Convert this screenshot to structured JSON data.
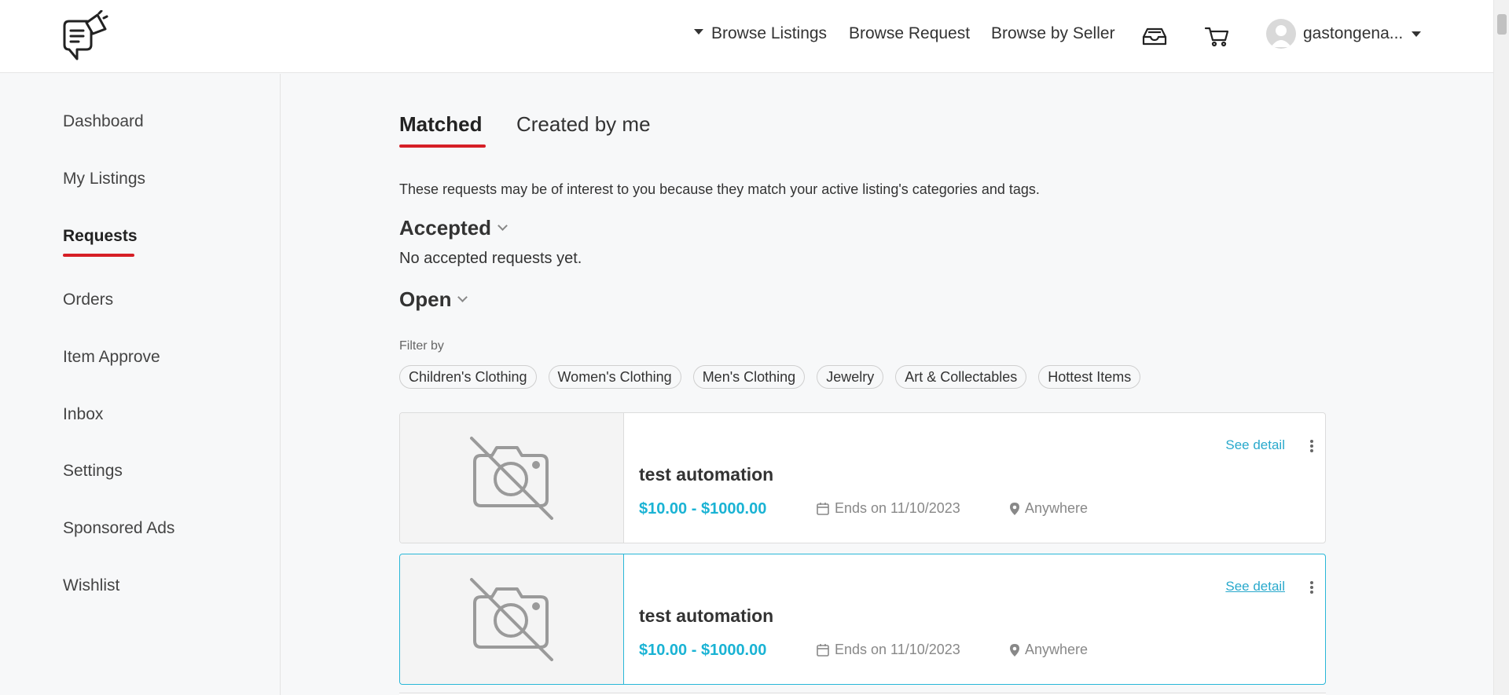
{
  "header": {
    "nav": {
      "browse_listings": "Browse Listings",
      "browse_request": "Browse Request",
      "browse_by_seller": "Browse by Seller"
    },
    "icons": [
      "inbox-tray-icon",
      "cart-icon"
    ],
    "user": {
      "name": "gastongena..."
    }
  },
  "sidebar": {
    "items": [
      {
        "label": "Dashboard"
      },
      {
        "label": "My Listings"
      },
      {
        "label": "Requests",
        "active": true
      },
      {
        "label": "Orders"
      },
      {
        "label": "Item Approve"
      },
      {
        "label": "Inbox"
      },
      {
        "label": "Settings"
      },
      {
        "label": "Sponsored Ads"
      },
      {
        "label": "Wishlist"
      }
    ]
  },
  "main": {
    "tabs": [
      {
        "label": "Matched",
        "active": true
      },
      {
        "label": "Created by me"
      }
    ],
    "intro": "These requests may be of interest to you because they match your active listing's categories and tags.",
    "accepted": {
      "title": "Accepted",
      "empty_message": "No accepted requests yet."
    },
    "open": {
      "title": "Open",
      "filter_label": "Filter by",
      "filters": [
        "Children's Clothing",
        "Women's Clothing",
        "Men's Clothing",
        "Jewelry",
        "Art & Collectables",
        "Hottest Items"
      ],
      "cards": [
        {
          "title": "test automation",
          "price": "$10.00 - $1000.00",
          "ends": "Ends on 11/10/2023",
          "location": "Anywhere",
          "see_detail": "See detail"
        },
        {
          "title": "test automation",
          "price": "$10.00 - $1000.00",
          "ends": "Ends on 11/10/2023",
          "location": "Anywhere",
          "see_detail": "See detail"
        }
      ]
    }
  },
  "colors": {
    "accent_red": "#d61f26",
    "price_blue": "#1ab3d4",
    "highlight_border": "#29b7d8"
  }
}
